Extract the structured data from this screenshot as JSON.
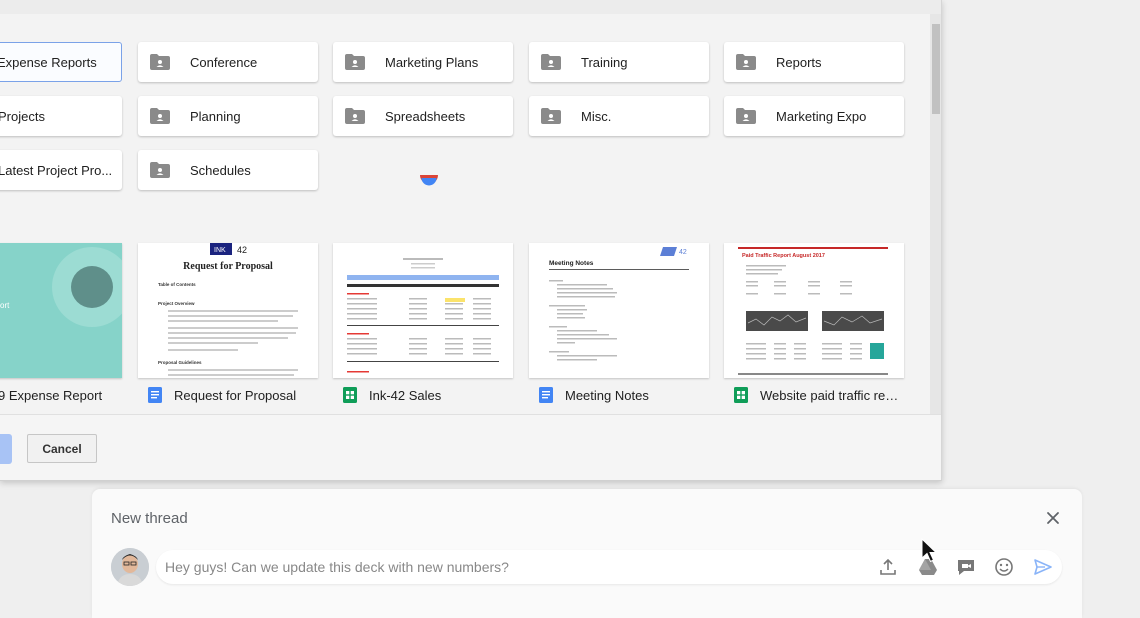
{
  "folders": [
    {
      "label": "Expense Reports",
      "selected": true
    },
    {
      "label": "Conference"
    },
    {
      "label": "Marketing Plans"
    },
    {
      "label": "Training"
    },
    {
      "label": "Reports"
    },
    {
      "label": "Projects"
    },
    {
      "label": "Planning"
    },
    {
      "label": "Spreadsheets"
    },
    {
      "label": "Misc."
    },
    {
      "label": "Marketing Expo"
    },
    {
      "label": "Latest Project Pro..."
    },
    {
      "label": "Schedules"
    }
  ],
  "files": [
    {
      "name": "9 Expense Report",
      "type": "slides",
      "thumb_text": "ort"
    },
    {
      "name": "Request for Proposal",
      "type": "doc",
      "thumb_title": "Request for Proposal",
      "thumb_brand": "INK",
      "thumb_brand_num": "42",
      "thumb_toc": "Table of Contents",
      "thumb_section": "Project Overview",
      "thumb_section2": "Proposal Guidelines"
    },
    {
      "name": "Ink-42 Sales",
      "type": "sheet"
    },
    {
      "name": "Meeting Notes",
      "type": "doc",
      "thumb_title": "Meeting Notes",
      "thumb_brand_num": "42"
    },
    {
      "name": "Website paid traffic rep...",
      "type": "sheet",
      "thumb_title": "Paid Traffic Report August 2017"
    }
  ],
  "footer": {
    "cancel_label": "Cancel"
  },
  "thread": {
    "title": "New thread",
    "message": "Hey guys! Can we update this deck with new numbers?"
  },
  "colors": {
    "doc_icon": "#4285f4",
    "sheet_icon": "#0f9d58",
    "folder_icon": "#8a8a8a",
    "selection_border": "#7aa2e8",
    "send_icon": "#8ab4f8"
  }
}
